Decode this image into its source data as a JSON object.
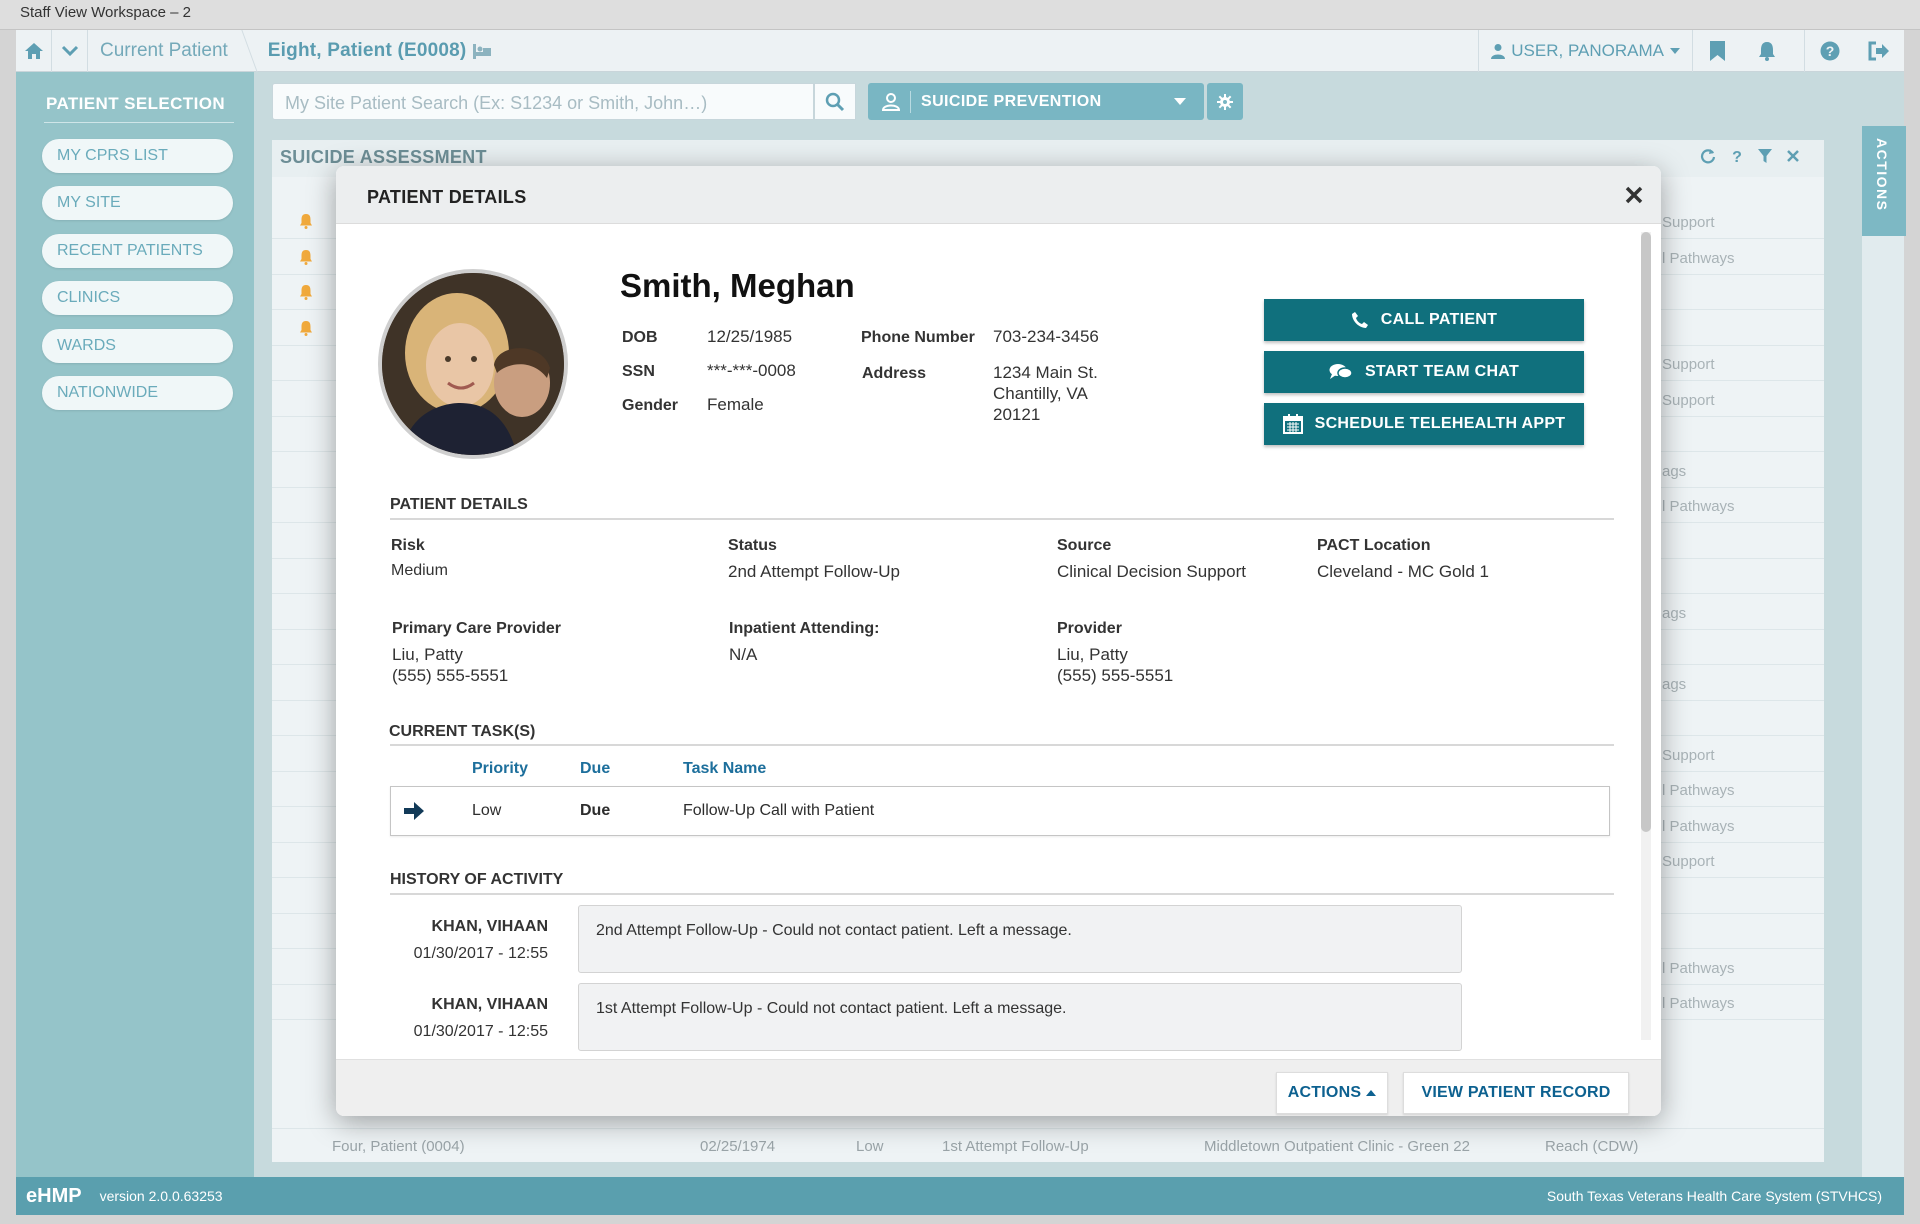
{
  "window": {
    "title": "Staff View Workspace – 2"
  },
  "nav": {
    "breadcrumb_current": "Current Patient",
    "breadcrumb_patient": "Eight, Patient (E0008)",
    "user": "USER, PANORAMA"
  },
  "sidebar": {
    "title": "PATIENT SELECTION",
    "items": [
      {
        "label": "MY CPRS LIST"
      },
      {
        "label": "MY SITE"
      },
      {
        "label": "RECENT PATIENTS"
      },
      {
        "label": "CLINICS"
      },
      {
        "label": "WARDS"
      },
      {
        "label": "NATIONWIDE"
      }
    ]
  },
  "search": {
    "placeholder": "My Site Patient Search (Ex: S1234 or Smith, John…)"
  },
  "workspace": {
    "selected": "SUICIDE PREVENTION"
  },
  "applet": {
    "title": "SUICIDE ASSESSMENT",
    "row_tails": [
      "Support",
      "l Pathways",
      "",
      "",
      "Support",
      "Support",
      "",
      "ags",
      "l Pathways",
      "",
      "",
      "ags",
      "",
      "ags",
      "",
      "Support",
      "l Pathways",
      "l Pathways",
      "Support",
      "",
      "",
      "l Pathways",
      "l Pathways"
    ],
    "last_row": {
      "name": "Four, Patient (0004)",
      "dob": "02/25/1974",
      "risk": "Low",
      "status": "1st Attempt Follow-Up",
      "location": "Middletown Outpatient Clinic - Green 22",
      "source": "Reach (CDW)"
    }
  },
  "actions_tab": {
    "label": "ACTIONS"
  },
  "modal": {
    "title": "PATIENT DETAILS",
    "patient": {
      "name": "Smith, Meghan",
      "dob_label": "DOB",
      "dob": "12/25/1985",
      "ssn_label": "SSN",
      "ssn": "***-***-0008",
      "gender_label": "Gender",
      "gender": "Female",
      "phone_label": "Phone Number",
      "phone": "703-234-3456",
      "address_label": "Address",
      "address_line1": "1234 Main St.",
      "address_line2": "Chantilly, VA",
      "address_line3": "20121"
    },
    "buttons": {
      "call": "CALL PATIENT",
      "chat": "START TEAM CHAT",
      "schedule": "SCHEDULE TELEHEALTH APPT"
    },
    "details": {
      "section_title": "PATIENT DETAILS",
      "risk_label": "Risk",
      "risk": "Medium",
      "status_label": "Status",
      "status": "2nd Attempt Follow-Up",
      "source_label": "Source",
      "source": "Clinical Decision Support",
      "pact_label": "PACT Location",
      "pact": "Cleveland - MC Gold 1",
      "pcp_label": "Primary Care Provider",
      "pcp_name": "Liu, Patty",
      "pcp_phone": "(555) 555-5551",
      "inpatient_label": "Inpatient Attending:",
      "inpatient": "N/A",
      "provider_label": "Provider",
      "provider_name": "Liu, Patty",
      "provider_phone": "(555) 555-5551"
    },
    "tasks": {
      "section_title": "CURRENT TASK(S)",
      "headers": {
        "priority": "Priority",
        "due": "Due",
        "task": "Task Name"
      },
      "rows": [
        {
          "priority": "Low",
          "due": "Due",
          "task": "Follow-Up Call with Patient"
        }
      ]
    },
    "history": {
      "section_title": "HISTORY OF ACTIVITY",
      "entries": [
        {
          "name": "KHAN, VIHAAN",
          "date": "01/30/2017 - 12:55",
          "note": "2nd Attempt Follow-Up - Could not contact patient. Left a message."
        },
        {
          "name": "KHAN, VIHAAN",
          "date": "01/30/2017 - 12:55",
          "note": "1st Attempt Follow-Up - Could not contact patient. Left a message."
        }
      ]
    },
    "footer": {
      "actions": "ACTIONS",
      "view_record": "VIEW PATIENT RECORD"
    }
  },
  "footer": {
    "brand": "eHMP",
    "version": "version 2.0.0.63253",
    "system": "South Texas Veterans Health Care System (STVHCS)"
  },
  "colors": {
    "accent": "#10707d",
    "sidebar": "#95c4c9",
    "link": "#1d6f9c",
    "footer": "#5a9fae"
  }
}
